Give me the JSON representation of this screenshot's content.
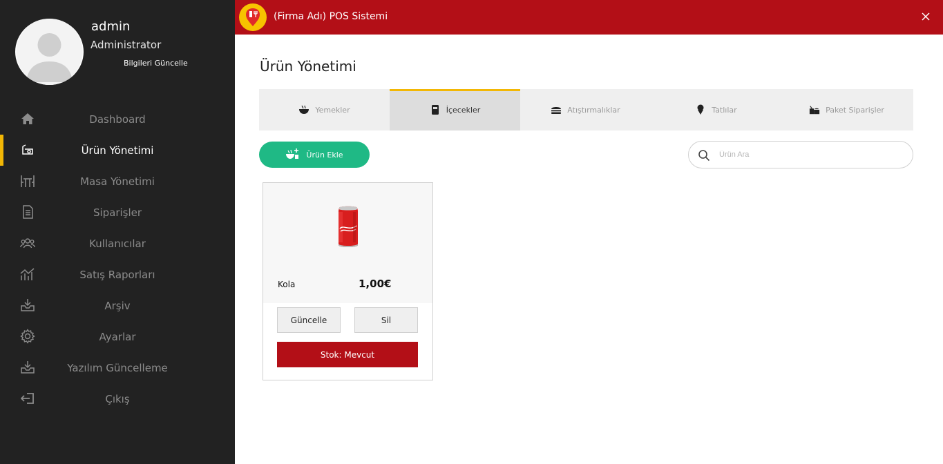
{
  "user": {
    "name": "admin",
    "role": "Administrator",
    "update_link": "Bilgileri Güncelle"
  },
  "sidebar": {
    "items": [
      {
        "label": "Dashboard",
        "icon": "home-icon"
      },
      {
        "label": "Ürün Yönetimi",
        "icon": "product-icon",
        "active": true
      },
      {
        "label": "Masa Yönetimi",
        "icon": "table-icon"
      },
      {
        "label": "Siparişler",
        "icon": "orders-icon"
      },
      {
        "label": "Kullanıcılar",
        "icon": "users-icon"
      },
      {
        "label": "Satış Raporları",
        "icon": "chart-icon"
      },
      {
        "label": "Arşiv",
        "icon": "archive-icon"
      },
      {
        "label": "Ayarlar",
        "icon": "gear-icon"
      },
      {
        "label": "Yazılım Güncelleme",
        "icon": "download-icon"
      },
      {
        "label": "Çıkış",
        "icon": "logout-icon"
      }
    ]
  },
  "header": {
    "title": "(Firma Adı) POS Sistemi"
  },
  "main": {
    "page_title": "Ürün Yönetimi",
    "tabs": [
      {
        "label": "Yemekler",
        "icon": "bowl-icon"
      },
      {
        "label": "İçecekler",
        "icon": "cup-icon",
        "active": true
      },
      {
        "label": "Atıştırmalıklar",
        "icon": "burger-icon"
      },
      {
        "label": "Tatlılar",
        "icon": "icecream-icon"
      },
      {
        "label": "Paket Siparişler",
        "icon": "takeaway-icon"
      }
    ],
    "add_button": "Ürün Ekle",
    "search_placeholder": "Ürün Ara"
  },
  "products": [
    {
      "name": "Kola",
      "price": "1,00€",
      "update_label": "Güncelle",
      "delete_label": "Sil",
      "stock_label": "Stok: Mevcut"
    }
  ],
  "colors": {
    "header_red": "#b30f17",
    "sidebar_bg": "#222222",
    "accent_yellow": "#f2b705",
    "add_green": "#1fb985"
  }
}
